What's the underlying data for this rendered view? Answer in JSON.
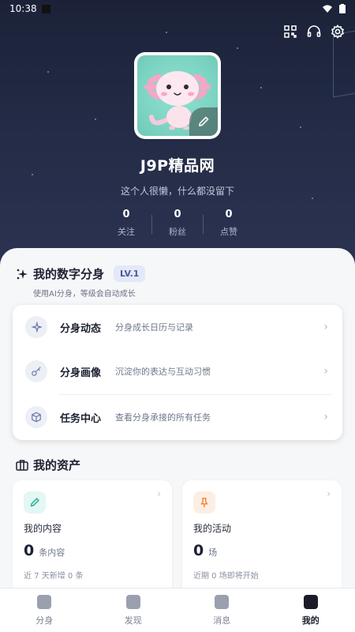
{
  "status_bar": {
    "time": "10:38"
  },
  "header": {
    "icons": [
      "qr-code-icon",
      "headset-icon",
      "settings-icon"
    ]
  },
  "profile": {
    "username": "J9P精品网",
    "bio": "这个人很懒，什么都没留下",
    "stats": [
      {
        "value": "0",
        "label": "关注"
      },
      {
        "value": "0",
        "label": "粉丝"
      },
      {
        "value": "0",
        "label": "点赞"
      }
    ]
  },
  "digital_self": {
    "title": "我的数字分身",
    "level": "LV.1",
    "subtitle": "使用AI分身，等级会自动成长",
    "items": [
      {
        "title": "分身动态",
        "desc": "分身成长日历与记录",
        "icon": "sparkle-icon"
      },
      {
        "title": "分身画像",
        "desc": "沉淀你的表达与互动习惯",
        "icon": "key-icon"
      },
      {
        "title": "任务中心",
        "desc": "查看分身承接的所有任务",
        "icon": "cube-icon"
      }
    ]
  },
  "assets": {
    "title": "我的资产",
    "cards": [
      {
        "title": "我的内容",
        "count": "0",
        "unit": "条内容",
        "note": "近 7 天新增 0 条",
        "icon": "pencil-icon",
        "color": "#e3f7f3"
      },
      {
        "title": "我的活动",
        "count": "0",
        "unit": "场",
        "note": "近期 0 场即将开始",
        "icon": "pin-icon",
        "color": "#fdeee3"
      }
    ]
  },
  "tabbar": {
    "tabs": [
      {
        "label": "分身",
        "active": false
      },
      {
        "label": "发现",
        "active": false
      },
      {
        "label": "消息",
        "active": false
      },
      {
        "label": "我的",
        "active": true
      }
    ]
  },
  "colors": {
    "hero_bg": "#1b2238",
    "accent_teal": "#2bb39a",
    "accent_orange": "#f08a3c"
  }
}
